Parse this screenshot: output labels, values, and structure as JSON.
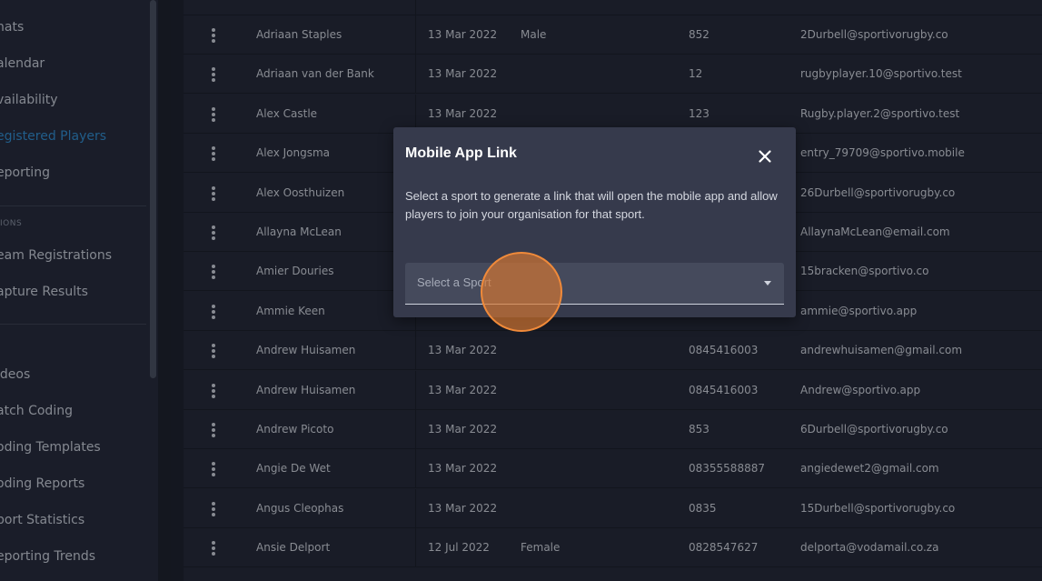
{
  "sidebar": {
    "items": [
      {
        "label": "hats",
        "active": false
      },
      {
        "label": "alendar",
        "active": false
      },
      {
        "label": "vailability",
        "active": false
      },
      {
        "label": "egistered Players",
        "active": true
      },
      {
        "label": "eporting",
        "active": false
      }
    ],
    "section_label": "IONS",
    "section_items": [
      {
        "label": "eam Registrations"
      },
      {
        "label": "apture Results"
      }
    ],
    "video_items": [
      {
        "label": "ideos"
      },
      {
        "label": "atch Coding"
      },
      {
        "label": "oding Templates"
      },
      {
        "label": "oding Reports"
      },
      {
        "label": "port Statistics"
      },
      {
        "label": "eporting Trends"
      }
    ]
  },
  "table": {
    "rows": [
      {
        "name": "Adriaan Staples",
        "date": "13 Mar 2022",
        "gender": "Male",
        "phone": "852",
        "email": "2Durbell@sportivorugby.co"
      },
      {
        "name": "Adriaan van der Bank",
        "date": "13 Mar 2022",
        "gender": "",
        "phone": "12",
        "email": "rugbyplayer.10@sportivo.test"
      },
      {
        "name": "Alex Castle",
        "date": "13 Mar 2022",
        "gender": "",
        "phone": "123",
        "email": "Rugby.player.2@sportivo.test"
      },
      {
        "name": "Alex Jongsma",
        "date": "",
        "gender": "",
        "phone": "",
        "email": "entry_79709@sportivo.mobile"
      },
      {
        "name": "Alex Oosthuizen",
        "date": "",
        "gender": "",
        "phone": "",
        "email": "26Durbell@sportivorugby.co"
      },
      {
        "name": "Allayna McLean",
        "date": "",
        "gender": "",
        "phone": "",
        "email": "AllaynaMcLean@email.com"
      },
      {
        "name": "Amier Douries",
        "date": "",
        "gender": "",
        "phone": "",
        "email": "15bracken@sportivo.co"
      },
      {
        "name": "Ammie Keen",
        "date": "",
        "gender": "",
        "phone": "",
        "email": "ammie@sportivo.app"
      },
      {
        "name": "Andrew Huisamen",
        "date": "13 Mar 2022",
        "gender": "",
        "phone": "0845416003",
        "email": "andrewhuisamen@gmail.com"
      },
      {
        "name": "Andrew Huisamen",
        "date": "13 Mar 2022",
        "gender": "",
        "phone": "0845416003",
        "email": "Andrew@sportivo.app"
      },
      {
        "name": "Andrew Picoto",
        "date": "13 Mar 2022",
        "gender": "",
        "phone": "853",
        "email": "6Durbell@sportivorugby.co"
      },
      {
        "name": "Angie De Wet",
        "date": "13 Mar 2022",
        "gender": "",
        "phone": "08355588887",
        "email": "angiedewet2@gmail.com"
      },
      {
        "name": "Angus Cleophas",
        "date": "13 Mar 2022",
        "gender": "",
        "phone": "0835",
        "email": "15Durbell@sportivorugby.co"
      },
      {
        "name": "Ansie Delport",
        "date": "12 Jul 2022",
        "gender": "Female",
        "phone": "0828547627",
        "email": "delporta@vodamail.co.za"
      }
    ]
  },
  "modal": {
    "title": "Mobile App Link",
    "description": "Select a sport to generate a link that will open the mobile app and allow players to join your organisation for that sport.",
    "select_placeholder": "Select a Sport"
  },
  "colors": {
    "accent": "#2f8fd3",
    "click_marker": "#f08a3a"
  }
}
